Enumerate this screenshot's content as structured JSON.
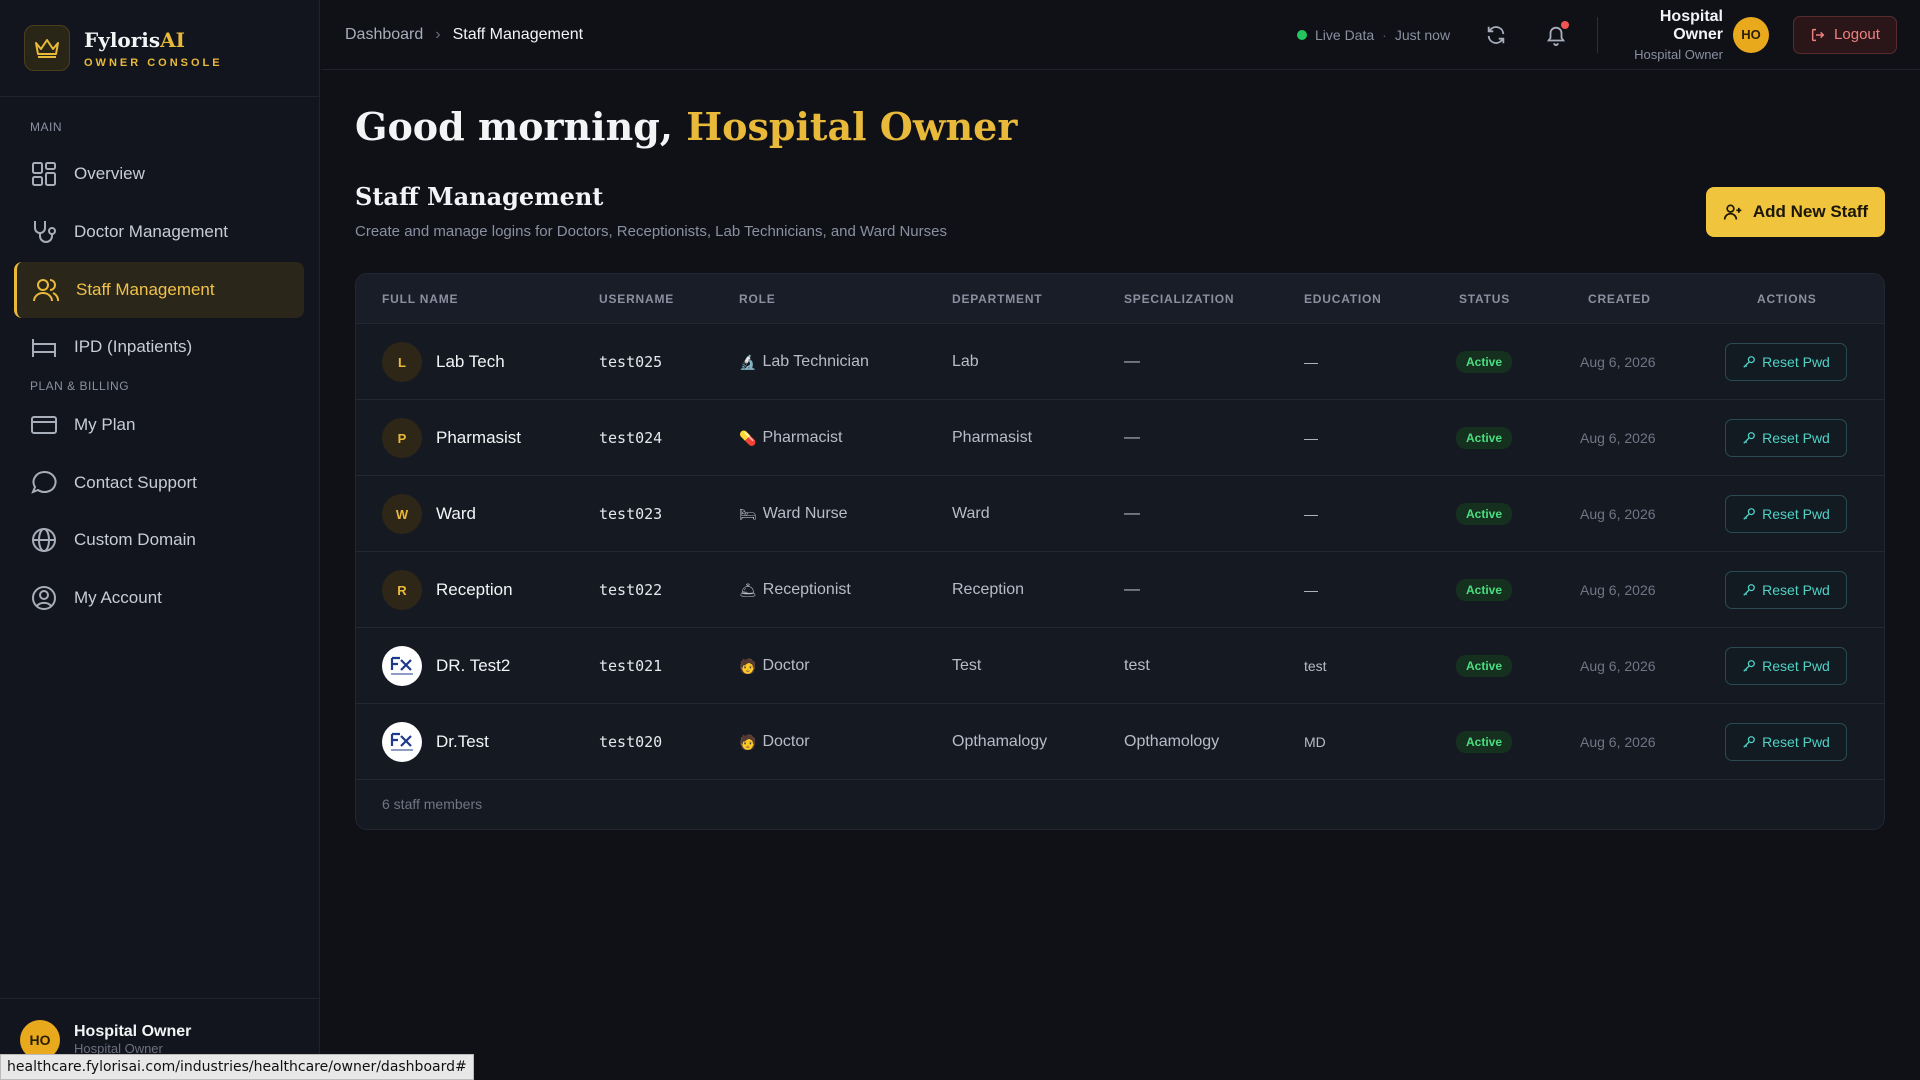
{
  "brand": {
    "name_main": "Fyloris",
    "name_accent": "AI",
    "subtitle": "OWNER CONSOLE"
  },
  "sidebar": {
    "section_main": "MAIN",
    "section_billing": "PLAN & BILLING",
    "items": [
      {
        "label": "Overview",
        "icon": "grid-icon"
      },
      {
        "label": "Doctor Management",
        "icon": "stethoscope-icon"
      },
      {
        "label": "Staff Management",
        "icon": "users-icon",
        "active": true
      },
      {
        "label": "IPD (Inpatients)",
        "icon": "bed-icon"
      },
      {
        "label": "My Plan",
        "icon": "credit-card-icon"
      },
      {
        "label": "Contact Support",
        "icon": "chat-icon"
      },
      {
        "label": "Custom Domain",
        "icon": "globe-icon"
      },
      {
        "label": "My Account",
        "icon": "user-circle-icon"
      }
    ],
    "footer": {
      "initials": "HO",
      "name": "Hospital Owner",
      "role": "Hospital Owner"
    }
  },
  "topbar": {
    "breadcrumb": [
      "Dashboard",
      "Staff Management"
    ],
    "live_label": "Live Data",
    "updated": "Just now",
    "user_name": "Hospital Owner",
    "user_role": "Hospital Owner",
    "user_initials": "HO",
    "logout_label": "Logout"
  },
  "main": {
    "greeting_prefix": "Good morning,",
    "greeting_name": "Hospital Owner",
    "title": "Staff Management",
    "subtitle": "Create and manage logins for Doctors, Receptionists, Lab Technicians, and Ward Nurses",
    "add_button": "Add New Staff"
  },
  "table": {
    "columns": [
      "FULL NAME",
      "USERNAME",
      "ROLE",
      "DEPARTMENT",
      "SPECIALIZATION",
      "EDUCATION",
      "STATUS",
      "CREATED",
      "ACTIONS"
    ],
    "rows": [
      {
        "initial": "L",
        "name": "Lab Tech",
        "username": "test025",
        "role_icon": "🔬",
        "role": "Lab Technician",
        "department": "Lab",
        "specialization": "—",
        "education": "—",
        "status": "Active",
        "created": "Aug 6, 2026",
        "action": "Reset Pwd"
      },
      {
        "initial": "P",
        "name": "Pharmasist",
        "username": "test024",
        "role_icon": "💊",
        "role": "Pharmacist",
        "department": "Pharmasist",
        "specialization": "—",
        "education": "—",
        "status": "Active",
        "created": "Aug 6, 2026",
        "action": "Reset Pwd"
      },
      {
        "initial": "W",
        "name": "Ward",
        "username": "test023",
        "role_icon": "🛏",
        "role": "Ward Nurse",
        "department": "Ward",
        "specialization": "—",
        "education": "—",
        "status": "Active",
        "created": "Aug 6, 2026",
        "action": "Reset Pwd"
      },
      {
        "initial": "R",
        "name": "Reception",
        "username": "test022",
        "role_icon": "🛎",
        "role": "Receptionist",
        "department": "Reception",
        "specialization": "—",
        "education": "—",
        "status": "Active",
        "created": "Aug 6, 2026",
        "action": "Reset Pwd"
      },
      {
        "initial": "",
        "logo": true,
        "name": "DR. Test2",
        "username": "test021",
        "role_icon": "🧑",
        "role": "Doctor",
        "department": "Test",
        "specialization": "test",
        "education": "test",
        "status": "Active",
        "created": "Aug 6, 2026",
        "action": "Reset Pwd"
      },
      {
        "initial": "",
        "logo": true,
        "name": "Dr.Test",
        "username": "test020",
        "role_icon": "🧑",
        "role": "Doctor",
        "department": "Opthamalogy",
        "specialization": "Opthamology",
        "education": "MD",
        "status": "Active",
        "created": "Aug 6, 2026",
        "action": "Reset Pwd"
      }
    ],
    "footer": "6 staff members"
  },
  "status_bar_url": "healthcare.fylorisai.com/industries/healthcare/owner/dashboard#",
  "colors": {
    "accent": "#e9b93a",
    "success": "#4ade80",
    "danger": "#f08080",
    "teal": "#4fd1c5"
  }
}
